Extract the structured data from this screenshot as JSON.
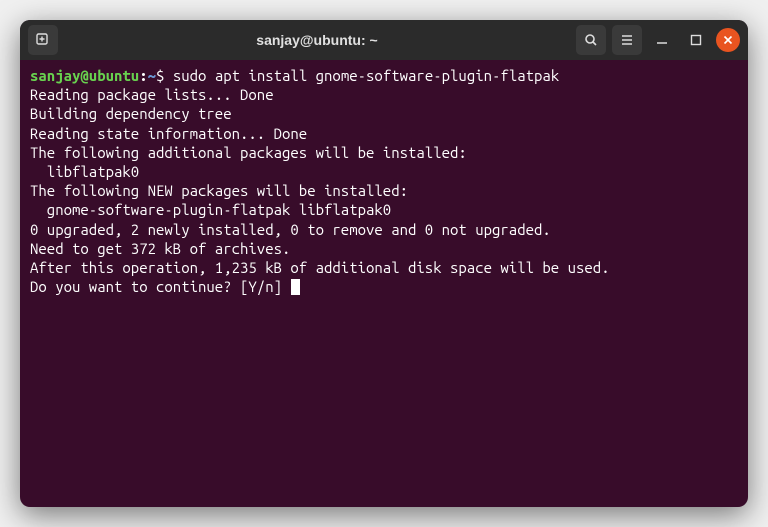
{
  "window": {
    "title": "sanjay@ubuntu: ~"
  },
  "prompt": {
    "user_host": "sanjay@ubuntu",
    "colon": ":",
    "path": "~",
    "symbol": "$"
  },
  "command": "sudo apt install gnome-software-plugin-flatpak",
  "output": {
    "l1": "Reading package lists... Done",
    "l2": "Building dependency tree",
    "l3": "Reading state information... Done",
    "l4": "The following additional packages will be installed:",
    "l5": "  libflatpak0",
    "l6": "The following NEW packages will be installed:",
    "l7": "  gnome-software-plugin-flatpak libflatpak0",
    "l8": "0 upgraded, 2 newly installed, 0 to remove and 0 not upgraded.",
    "l9": "Need to get 372 kB of archives.",
    "l10": "After this operation, 1,235 kB of additional disk space will be used.",
    "l11": "Do you want to continue? [Y/n] "
  }
}
